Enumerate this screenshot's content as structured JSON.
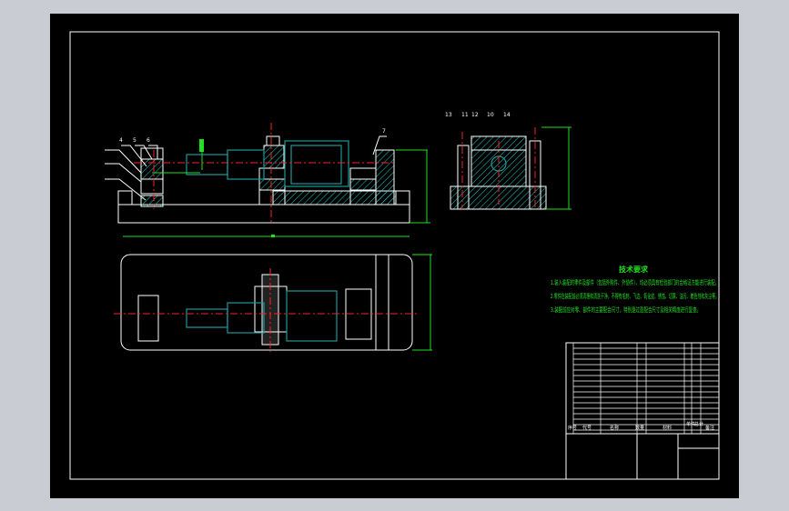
{
  "drawing": {
    "tech_requirements": {
      "title": "技术要求",
      "lines": [
        "1.装入装配的零件及部件（包括外购件、外协件），均必须具有检验部门的合格证方能进行装配。",
        "2.零件在装配前必须清理和清洗干净，不得有毛刺、飞边、氧化皮、锈蚀、切屑、油污、着色剂和灰尘等。",
        "3.装配前应对零、部件的主要配合尺寸，特别是过盈配合尺寸及相关精度进行复查。"
      ]
    },
    "bom_header": [
      "序号",
      "代号",
      "名称",
      "数量",
      "材料",
      "单件",
      "总计",
      "备注"
    ],
    "front_view_labels": [
      "4",
      "5",
      "6",
      "7"
    ],
    "side_view_labels": [
      "13",
      "11",
      "12",
      "10",
      "14"
    ],
    "colors": {
      "background": "#000000",
      "outline": "#ffffff",
      "part": "#1a9a9a",
      "centerline": "#ff2020",
      "dimension": "#20e020",
      "frame": "#c9ccd3"
    }
  }
}
